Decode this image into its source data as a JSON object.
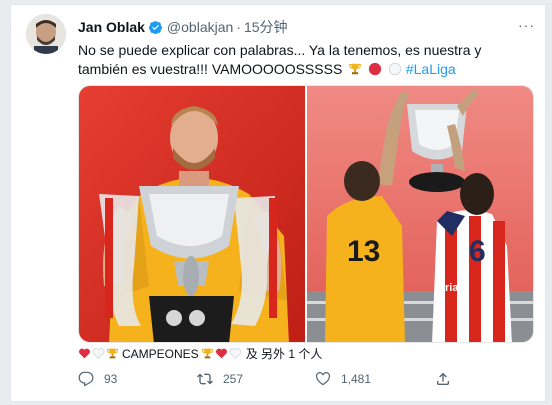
{
  "tweet": {
    "author_name": "Jan Oblak",
    "handle": "@oblakjan",
    "separator": "·",
    "time": "15分钟",
    "more_label": "···",
    "text_main": "No se puede explicar con palabras... Ya la tenemos, es nuestra y también es vuestra!!! VAMOOOOOSSSSS",
    "hashtag": "#LaLiga",
    "icons": [
      "trophy-emoji",
      "red-heart-emoji",
      "white-circle-emoji"
    ]
  },
  "media": {
    "left_photo": {
      "jersey_color": "#f5b21d",
      "background_color": "#d8261c"
    },
    "right_photo": {
      "jersey_number_back": "13",
      "jersey_number_right": "6",
      "sponsor_text": "ria"
    }
  },
  "reactions": {
    "label": "CAMPEONES",
    "others_text": "及 另外 1 个人"
  },
  "actions": {
    "reply_count": "93",
    "retweet_count": "257",
    "like_count": "1,481"
  },
  "colors": {
    "accent": "#1d9bf0",
    "text": "#0f1419",
    "muted": "#536471",
    "atletico_red": "#d8261c"
  }
}
